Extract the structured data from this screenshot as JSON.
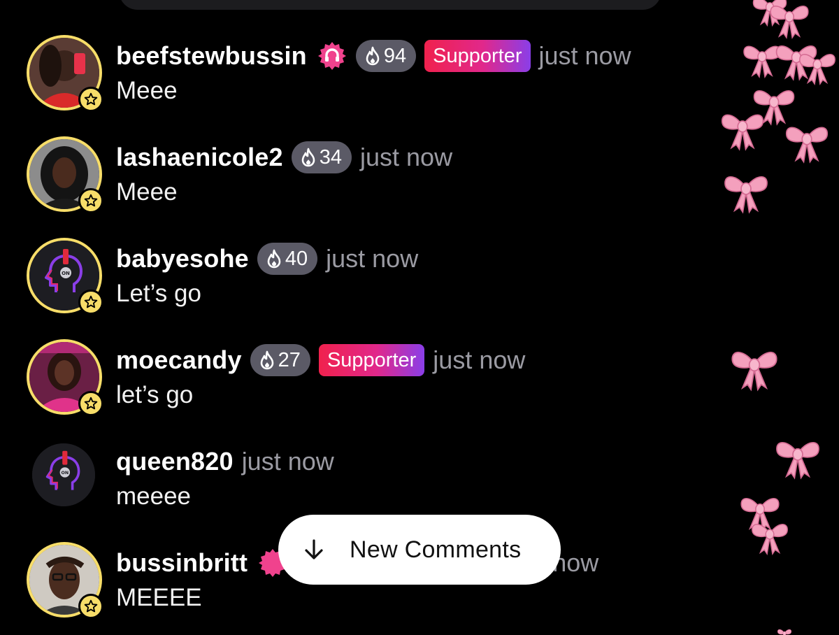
{
  "comments": [
    {
      "username": "beefstewbussin",
      "fire_count": "94",
      "badge": "Supporter",
      "time": "just now",
      "message": "Meee",
      "has_verify": true
    },
    {
      "username": "lashaenicole2",
      "fire_count": "34",
      "time": "just now",
      "message": "Meee"
    },
    {
      "username": "babyesohe",
      "fire_count": "40",
      "time": "just now",
      "message": "Let’s go"
    },
    {
      "username": "moecandy",
      "fire_count": "27",
      "badge": "Supporter",
      "time": "just now",
      "message": "let’s go"
    },
    {
      "username": "queen820",
      "time": "just now",
      "message": "meeee"
    },
    {
      "username": "bussinbritt",
      "time": "just now",
      "message": "MEEEE",
      "has_verify": true
    }
  ],
  "new_comments_button": {
    "label": "New Comments",
    "icon": "arrow-down-icon"
  },
  "colors": {
    "background": "#000000",
    "ring": "#f7dd69",
    "fire_pill": "#5b5a66",
    "supporter_start": "#f0214d",
    "supporter_end": "#8a3ee8",
    "verify": "#f0428d",
    "timestamp": "#9b9ba3",
    "bow": "#f4a0bd"
  }
}
